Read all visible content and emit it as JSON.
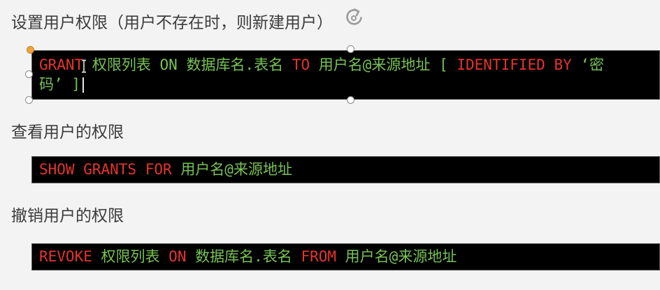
{
  "colors": {
    "background": "#f3f3f3",
    "heading": "#3c3c3c",
    "code_background": "#000000",
    "keyword": "#e7342b",
    "value": "#78c257",
    "handle_accent": "#f0a23b"
  },
  "icons": {
    "rotate": "rotate-handle-icon",
    "pointer": "i-beam-cursor-icon"
  },
  "sections": [
    {
      "heading": "设置用户权限（用户不存在时，则新建用户）",
      "code_lines": [
        [
          {
            "text": "GRANT",
            "keyword": true
          },
          {
            "text": "权限列表",
            "keyword": false
          },
          {
            "text": "ON",
            "keyword": false
          },
          {
            "text": "数据库名.表名",
            "keyword": false
          },
          {
            "text": "TO",
            "keyword": true
          },
          {
            "text": "用户名@来源地址",
            "keyword": false
          },
          {
            "text": "[",
            "keyword": false
          },
          {
            "text": "IDENTIFIED BY",
            "keyword": true
          },
          {
            "text": "‘密",
            "keyword": false
          }
        ],
        [
          {
            "text": "码’",
            "keyword": false
          },
          {
            "text": "]",
            "keyword": false
          }
        ]
      ]
    },
    {
      "heading": "查看用户的权限",
      "code_lines": [
        [
          {
            "text": "SHOW GRANTS FOR",
            "keyword": true
          },
          {
            "text": "用户名@来源地址",
            "keyword": false
          }
        ]
      ]
    },
    {
      "heading": "撤销用户的权限",
      "code_lines": [
        [
          {
            "text": "REVOKE",
            "keyword": true
          },
          {
            "text": "权限列表",
            "keyword": false
          },
          {
            "text": "ON",
            "keyword": true
          },
          {
            "text": "数据库名.表名",
            "keyword": false
          },
          {
            "text": "FROM",
            "keyword": true
          },
          {
            "text": "用户名@来源地址",
            "keyword": false
          }
        ]
      ]
    }
  ]
}
